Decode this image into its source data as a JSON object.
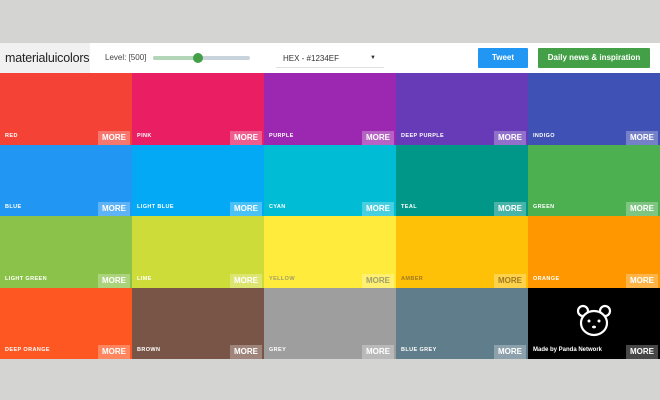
{
  "header": {
    "logo": "materialuicolors",
    "level_label": "Level: [500]",
    "format_select": "HEX - #1234EF",
    "tweet_label": "Tweet",
    "news_label": "Daily news & inspiration"
  },
  "colors": {
    "accent_tweet": "#2196f3",
    "accent_news": "#43a047"
  },
  "tiles": [
    {
      "name": "RED",
      "color": "#f44336",
      "text": "#ffffff",
      "more": "MORE"
    },
    {
      "name": "PINK",
      "color": "#e91e63",
      "text": "#ffffff",
      "more": "MORE"
    },
    {
      "name": "PURPLE",
      "color": "#9c27b0",
      "text": "#ffffff",
      "more": "MORE"
    },
    {
      "name": "DEEP PURPLE",
      "color": "#673ab7",
      "text": "#ffffff",
      "more": "MORE"
    },
    {
      "name": "INDIGO",
      "color": "#3f51b5",
      "text": "#ffffff",
      "more": "MORE"
    },
    {
      "name": "BLUE",
      "color": "#2196f3",
      "text": "#ffffff",
      "more": "MORE"
    },
    {
      "name": "LIGHT BLUE",
      "color": "#03a9f4",
      "text": "#ffffff",
      "more": "MORE"
    },
    {
      "name": "CYAN",
      "color": "#00bcd4",
      "text": "#ffffff",
      "more": "MORE"
    },
    {
      "name": "TEAL",
      "color": "#009688",
      "text": "#ffffff",
      "more": "MORE"
    },
    {
      "name": "GREEN",
      "color": "#4caf50",
      "text": "#ffffff",
      "more": "MORE"
    },
    {
      "name": "LIGHT GREEN",
      "color": "#8bc34a",
      "text": "#ffffff",
      "more": "MORE"
    },
    {
      "name": "LIME",
      "color": "#cddc39",
      "text": "#ffffff",
      "more": "MORE"
    },
    {
      "name": "YELLOW",
      "color": "#ffeb3b",
      "text": "#9e9e6a",
      "more": "MORE"
    },
    {
      "name": "AMBER",
      "color": "#ffc107",
      "text": "#a07a20",
      "more": "MORE"
    },
    {
      "name": "ORANGE",
      "color": "#ff9800",
      "text": "#ffffff",
      "more": "MORE"
    },
    {
      "name": "DEEP ORANGE",
      "color": "#ff5722",
      "text": "#ffffff",
      "more": "MORE"
    },
    {
      "name": "BROWN",
      "color": "#795548",
      "text": "#ffffff",
      "more": "MORE"
    },
    {
      "name": "GREY",
      "color": "#9e9e9e",
      "text": "#ffffff",
      "more": "MORE"
    },
    {
      "name": "BLUE GREY",
      "color": "#607d8b",
      "text": "#ffffff",
      "more": "MORE"
    },
    {
      "name": "",
      "color": "#000000",
      "text": "#ffffff",
      "more": "MORE",
      "credit": "Made by Panda Network"
    }
  ]
}
